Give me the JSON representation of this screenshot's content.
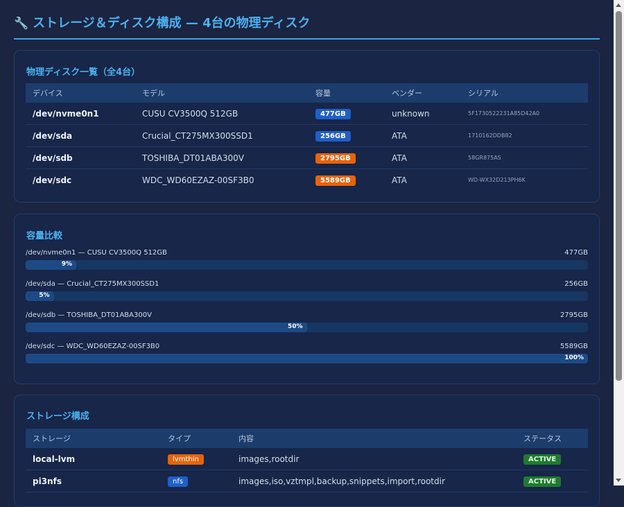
{
  "header": {
    "title": "ストレージ＆ディスク構成 — 4台の物理ディスク",
    "icon": "wrench-icon"
  },
  "disk_list": {
    "title": "物理ディスク一覧（全4台）",
    "columns": [
      "デバイス",
      "モデル",
      "容量",
      "ベンダー",
      "シリアル"
    ],
    "rows": [
      {
        "device": "/dev/nvme0n1",
        "model": "CUSU CV3500Q 512GB",
        "size": "477GB",
        "size_color": "blue",
        "vendor": "unknown",
        "serial": "5F1730522231A85D42A0"
      },
      {
        "device": "/dev/sda",
        "model": "Crucial_CT275MX300SSD1",
        "size": "256GB",
        "size_color": "blue",
        "vendor": "ATA",
        "serial": "1710162DDB82"
      },
      {
        "device": "/dev/sdb",
        "model": "TOSHIBA_DT01ABA300V",
        "size": "2795GB",
        "size_color": "orange",
        "vendor": "ATA",
        "serial": "58GR875AS"
      },
      {
        "device": "/dev/sdc",
        "model": "WDC_WD60EZAZ-00SF3B0",
        "size": "5589GB",
        "size_color": "orange",
        "vendor": "ATA",
        "serial": "WD-WX32D213PH6K"
      }
    ]
  },
  "capacity": {
    "title": "容量比較",
    "items": [
      {
        "label": "/dev/nvme0n1 — CUSU CV3500Q 512GB",
        "size": "477GB",
        "percent_label": "9%",
        "percent": 9
      },
      {
        "label": "/dev/sda — Crucial_CT275MX300SSD1",
        "size": "256GB",
        "percent_label": "5%",
        "percent": 5
      },
      {
        "label": "/dev/sdb — TOSHIBA_DT01ABA300V",
        "size": "2795GB",
        "percent_label": "50%",
        "percent": 50
      },
      {
        "label": "/dev/sdc — WDC_WD60EZAZ-00SF3B0",
        "size": "5589GB",
        "percent_label": "100%",
        "percent": 100
      }
    ]
  },
  "storage": {
    "title": "ストレージ構成",
    "columns": [
      "ストレージ",
      "タイプ",
      "内容",
      "ステータス"
    ],
    "rows": [
      {
        "name": "local-lvm",
        "type": "lvmthin",
        "type_color": "orange",
        "content": "images,rootdir",
        "status": "ACTIVE"
      },
      {
        "name": "pi3nfs",
        "type": "nfs",
        "type_color": "blue",
        "content": "images,iso,vztmpl,backup,snippets,import,rootdir",
        "status": "ACTIVE"
      }
    ]
  },
  "colors": {
    "accent": "#4cb0f0",
    "badge_blue": "#1f5fc8",
    "badge_orange": "#e6640c",
    "status_green": "#1e7a2e"
  }
}
